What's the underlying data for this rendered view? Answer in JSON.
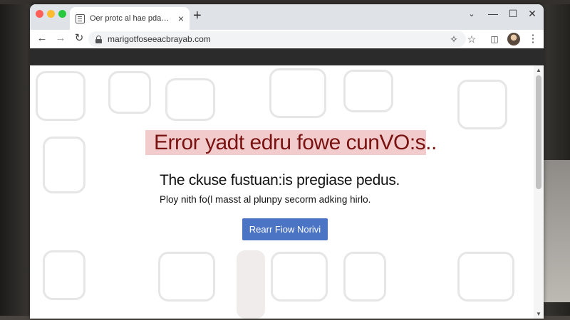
{
  "browser": {
    "tab": {
      "title": "Oer protc al hae pdaane ...",
      "close_icon": "close-icon",
      "favicon": "document-icon"
    },
    "new_tab_label": "+",
    "window_controls": {
      "chevron": "⌄",
      "minimize": "—",
      "maximize": "☐",
      "close": "✕"
    },
    "toolbar": {
      "back": "←",
      "forward": "→",
      "reload": "↻",
      "url": "marigotfoseeacbrayab.com",
      "extensions_icon": "puzzle-icon",
      "star_icon": "star-icon",
      "sidepanel_icon": "side-panel-icon",
      "avatar_icon": "profile-avatar",
      "menu_icon": "kebab-menu-icon"
    },
    "scrollbar": {
      "up": "▲",
      "down": "▼"
    }
  },
  "page": {
    "error_heading": "Error yadt edru fowe cunVO:s..",
    "error_title": "The ckuse fustuan:is pregiase pedus.",
    "error_detail": "Ploy nith fo(l masst al plunpy secorm adking hirlo.",
    "button_label": "Rearr Fiow Norivi"
  },
  "colors": {
    "accent_button": "#4c74c4",
    "error_band": "#f2cccc",
    "error_text": "#7a1212"
  }
}
